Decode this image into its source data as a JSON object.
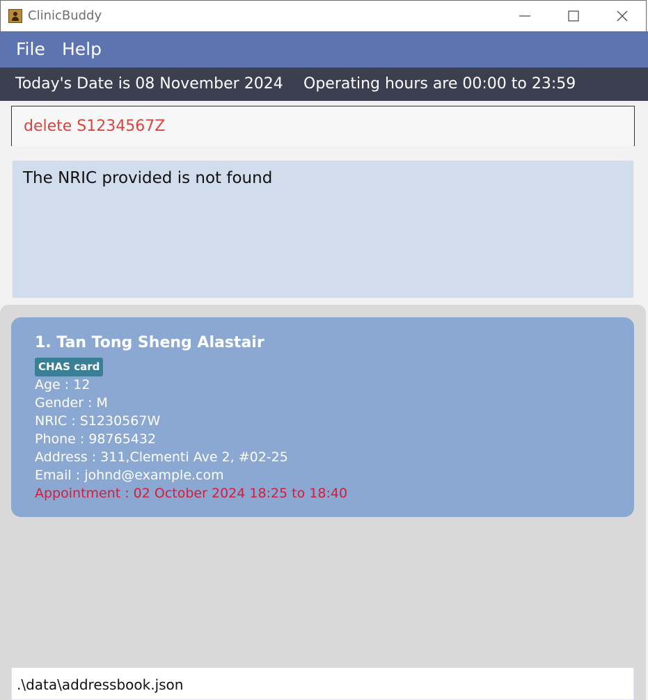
{
  "window": {
    "title": "ClinicBuddy",
    "icon": "app-contact-icon"
  },
  "menu": {
    "items": [
      {
        "label": "File"
      },
      {
        "label": "Help"
      }
    ]
  },
  "infobar": {
    "date_text": "Today's Date is 08 November 2024",
    "hours_text": "Operating hours are 00:00 to 23:59"
  },
  "command": {
    "value": "delete S1234567Z"
  },
  "result": {
    "message": "The NRIC provided is not found"
  },
  "persons": [
    {
      "name": "1. Tan Tong Sheng Alastair",
      "tag": "CHAS card",
      "age": "Age : 12",
      "gender": "Gender : M",
      "nric": "NRIC : S1230567W",
      "phone": "Phone : 98765432",
      "address": "Address : 311,Clementi Ave 2, #02-25",
      "email": "Email : johnd@example.com",
      "appointment": "Appointment : 02 October 2024 18:25 to 18:40"
    }
  ],
  "status": {
    "path": ".\\data\\addressbook.json"
  },
  "colors": {
    "menubar": "#5c74b0",
    "infobar": "#3c3f50",
    "command_text": "#d9443c",
    "result_bg": "#d1dcec",
    "card_bg": "#8aa8d1",
    "tag_bg": "#3b7f96",
    "appointment_text": "#d51c3a"
  }
}
